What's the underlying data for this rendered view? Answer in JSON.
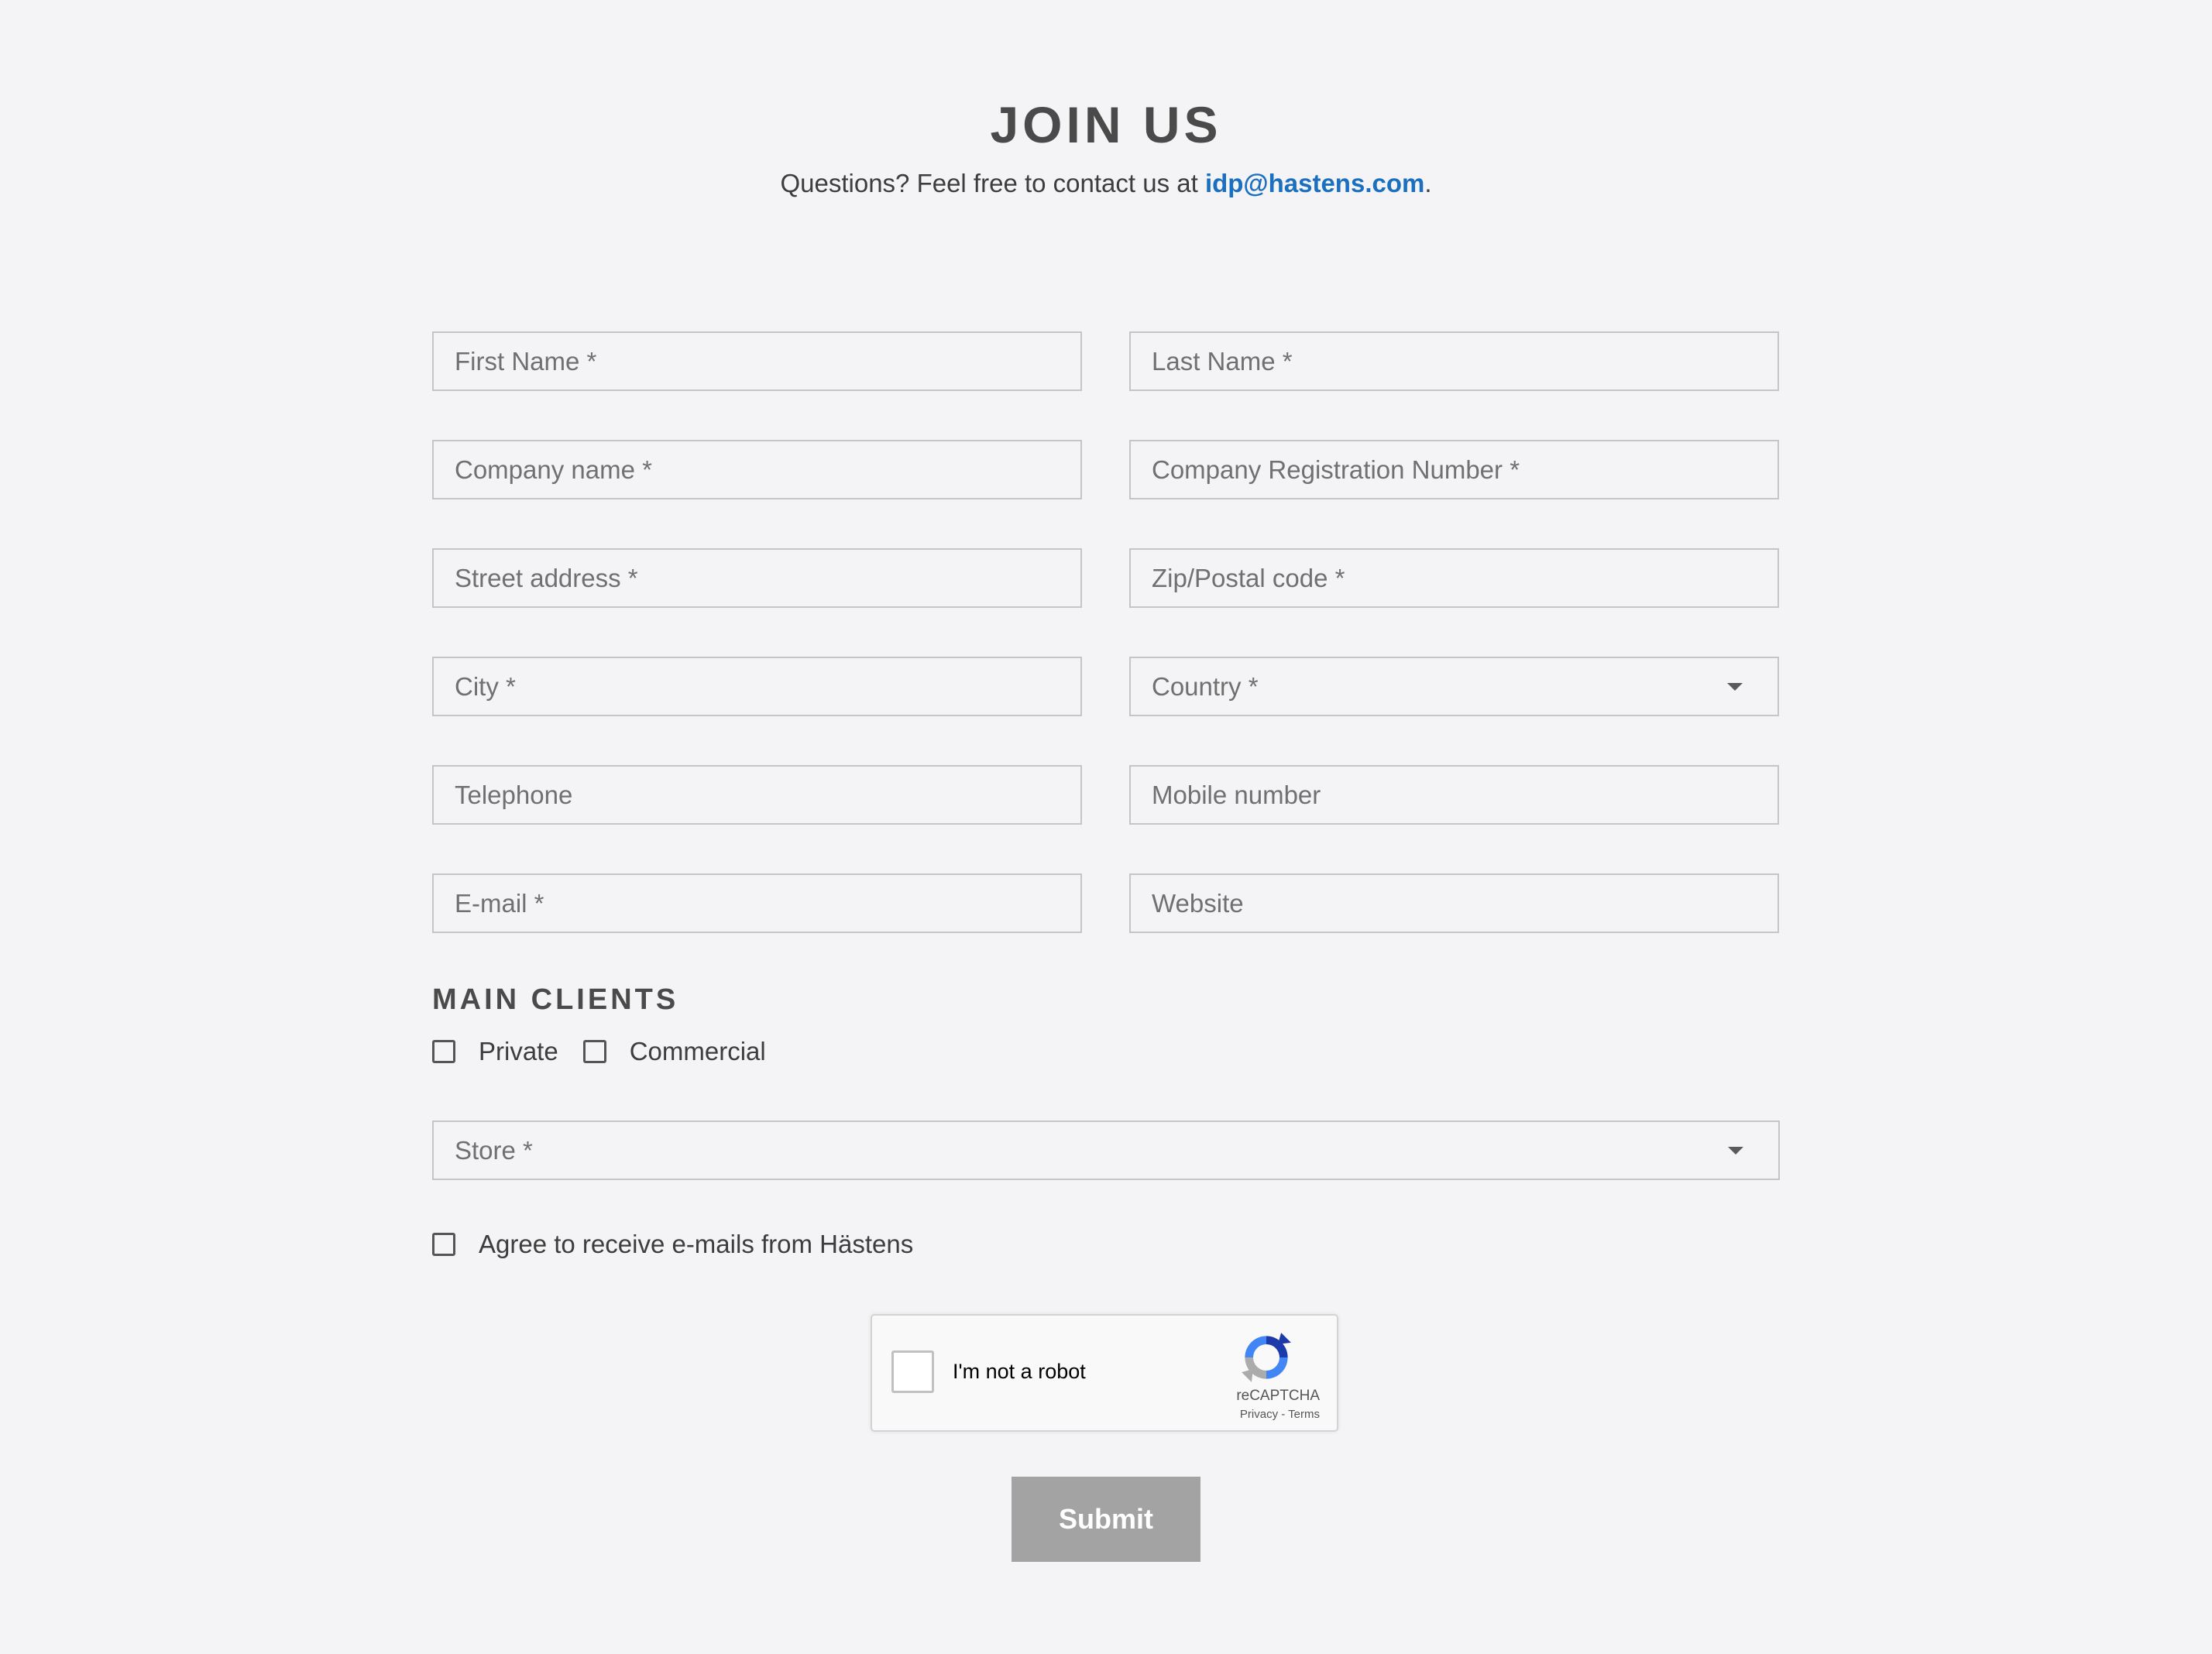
{
  "header": {
    "title": "JOIN US",
    "subtitle_prefix": "Questions? Feel free to contact us at ",
    "email": "idp@hastens.com",
    "subtitle_suffix": "."
  },
  "form": {
    "first_name": {
      "placeholder": "First Name *"
    },
    "last_name": {
      "placeholder": "Last Name *"
    },
    "company_name": {
      "placeholder": "Company name *"
    },
    "company_reg": {
      "placeholder": "Company Registration Number *"
    },
    "street": {
      "placeholder": "Street address *"
    },
    "zip": {
      "placeholder": "Zip/Postal code *"
    },
    "city": {
      "placeholder": "City *"
    },
    "country": {
      "label": "Country *"
    },
    "telephone": {
      "placeholder": "Telephone"
    },
    "mobile": {
      "placeholder": "Mobile number"
    },
    "email": {
      "placeholder": "E-mail *"
    },
    "website": {
      "placeholder": "Website"
    }
  },
  "main_clients": {
    "heading": "MAIN CLIENTS",
    "options": [
      {
        "label": "Private",
        "checked": false
      },
      {
        "label": "Commercial",
        "checked": false
      }
    ]
  },
  "store": {
    "label": "Store *"
  },
  "consent": {
    "label": "Agree to receive e-mails from Hästens",
    "checked": false
  },
  "captcha": {
    "text": "I'm not a robot",
    "brand": "reCAPTCHA",
    "privacy": "Privacy",
    "separator": " - ",
    "terms": "Terms"
  },
  "submit_label": "Submit",
  "colors": {
    "background": "#f4f4f6",
    "link": "#1a6fbf",
    "submit": "#a3a3a3",
    "field_border": "#c5c5c7"
  }
}
